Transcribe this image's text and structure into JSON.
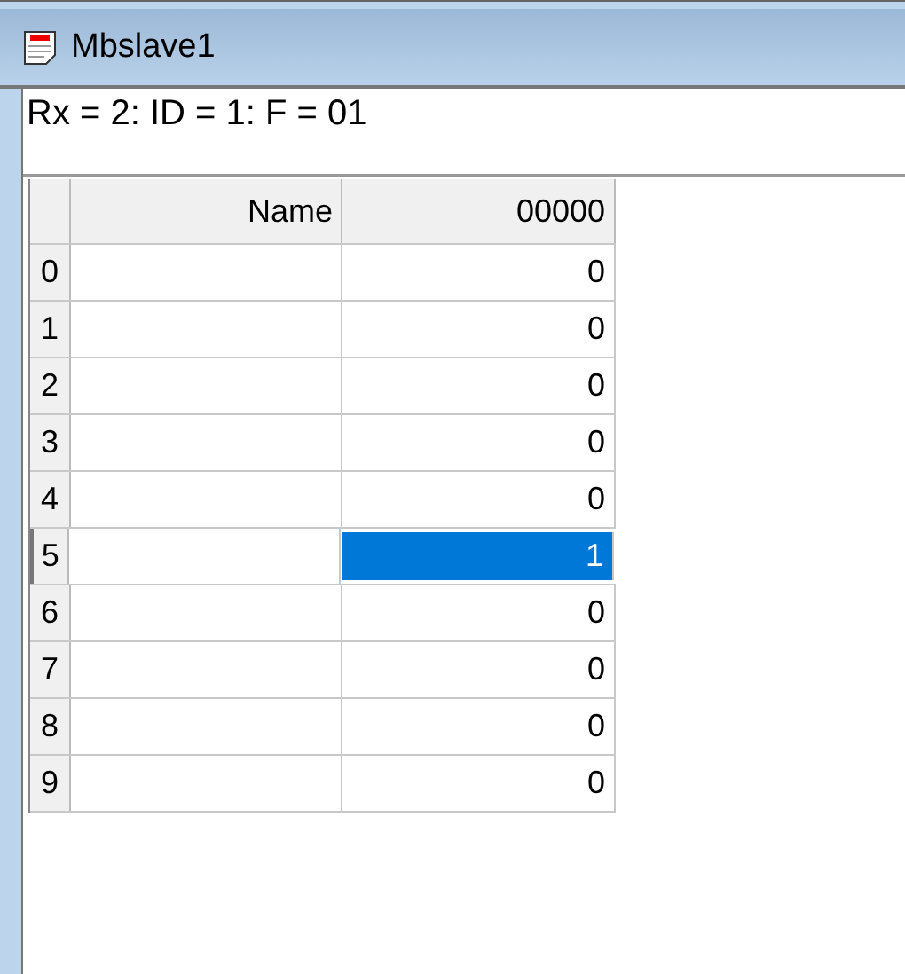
{
  "window": {
    "title": "Mbslave1"
  },
  "status": "Rx = 2: ID = 1: F = 01",
  "table": {
    "columns": [
      "Name",
      "00000"
    ],
    "rows": [
      {
        "index": "0",
        "value": "0",
        "selected": false
      },
      {
        "index": "1",
        "value": "0",
        "selected": false
      },
      {
        "index": "2",
        "value": "0",
        "selected": false
      },
      {
        "index": "3",
        "value": "0",
        "selected": false
      },
      {
        "index": "4",
        "value": "0",
        "selected": false
      },
      {
        "index": "5",
        "value": "1",
        "selected": true
      },
      {
        "index": "6",
        "value": "0",
        "selected": false
      },
      {
        "index": "7",
        "value": "0",
        "selected": false
      },
      {
        "index": "8",
        "value": "0",
        "selected": false
      },
      {
        "index": "9",
        "value": "0",
        "selected": false
      }
    ]
  }
}
